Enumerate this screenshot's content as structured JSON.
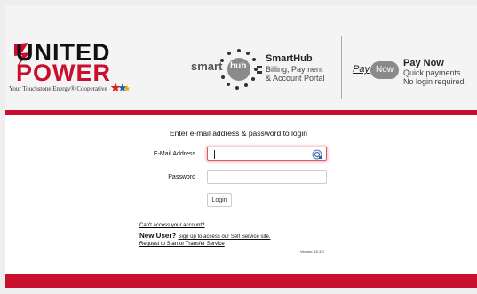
{
  "brand": {
    "name_line1": "UNITED",
    "name_line2": "POWER",
    "tagline": "Your Touchstone Energy® Cooperative"
  },
  "smarthub": {
    "smart_text": "smart",
    "hub_text": "hub",
    "title": "SmartHub",
    "subtitle_line1": "Billing, Payment",
    "subtitle_line2": "& Account Portal"
  },
  "paynow": {
    "logo_pay": "Pay",
    "logo_now": "Now",
    "title": "Pay Now",
    "subtitle_line1": "Quick payments.",
    "subtitle_line2": "No login required."
  },
  "login": {
    "heading": "Enter e-mail address & password to login",
    "email_label": "E-Mail Address",
    "email_value": "",
    "password_label": "Password",
    "password_value": "",
    "button_label": "Login"
  },
  "links": {
    "cant_access": "Can't access your account?",
    "new_user_label": "New User?",
    "sign_up": "Sign up to access our Self Service site.",
    "request_service": "Request to Start or Transfer Service",
    "version": "Version: 10.3.0"
  },
  "colors": {
    "accent_red": "#c8102e",
    "focus_border": "#e05a6a"
  },
  "icons": {
    "bolt": "lightning-bolt-icon",
    "password_manager": "password-manager-icon",
    "touchstone_stars": "touchstone-energy-logo"
  }
}
